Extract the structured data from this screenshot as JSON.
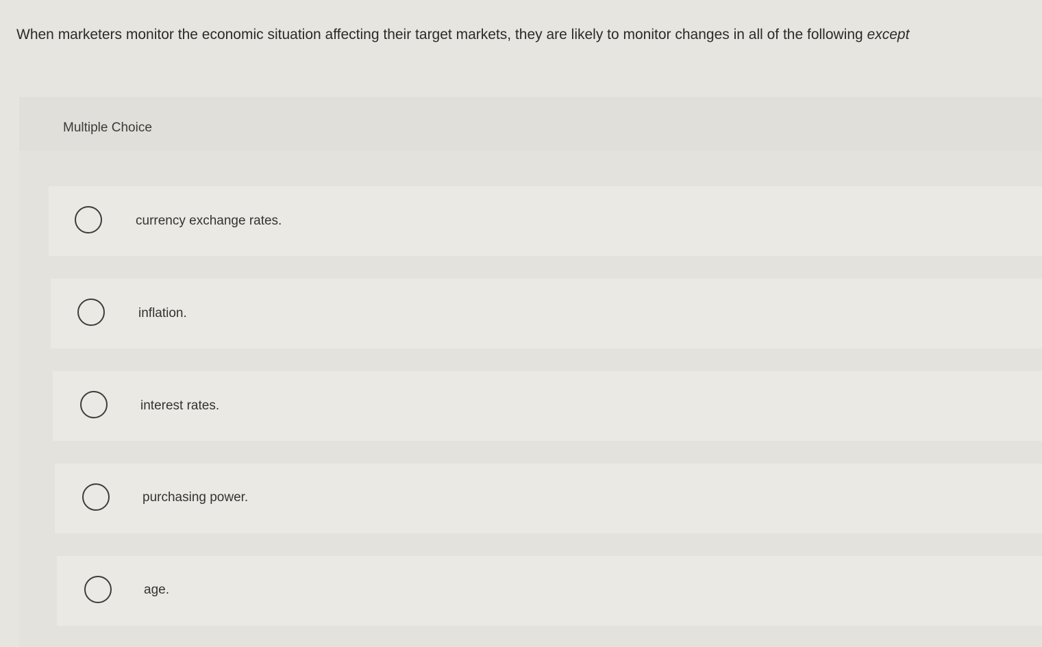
{
  "question": {
    "text": "When marketers monitor the economic situation affecting their target markets, they are likely to monitor changes in all of the following",
    "emphasis": "except"
  },
  "panel": {
    "title": "Multiple Choice"
  },
  "options": [
    {
      "label": "currency exchange rates."
    },
    {
      "label": "inflation."
    },
    {
      "label": "interest rates."
    },
    {
      "label": "purchasing power."
    },
    {
      "label": "age."
    }
  ],
  "colors": {
    "background": "#e7e5df",
    "panel": "#dfddd7",
    "option": "#ebe9e3",
    "radio_border": "#3c3c3c",
    "text": "#2b2b2b"
  }
}
